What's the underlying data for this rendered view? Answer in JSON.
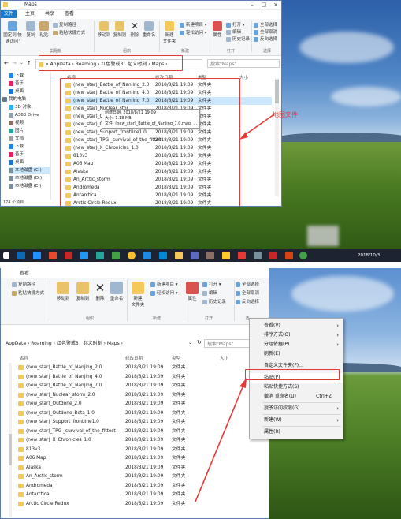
{
  "top": {
    "title": "Maps",
    "menu_tabs": [
      "文件",
      "主页",
      "共享",
      "查看"
    ],
    "ribbon": {
      "pin_label": "固定到'快速访问'",
      "copy_label": "复制",
      "paste_label": "粘贴",
      "copy_path": "复制路径",
      "paste_shortcut": "粘贴快捷方式",
      "move_to": "移动到",
      "copy_to": "复制到",
      "delete": "删除",
      "rename": "重命名",
      "new_folder": "新建\n文件夹",
      "new_item": "新建项目 ▾",
      "easy_access": "轻松访问 ▾",
      "properties": "属性",
      "open": "打开 ▾",
      "edit": "编辑",
      "history": "历史记录",
      "select_all": "全部选择",
      "select_none": "全部取消",
      "invert_select": "反向选择",
      "group_clipboard": "剪贴板",
      "group_organize": "组织",
      "group_new": "新建",
      "group_open": "打开",
      "group_select": "选择"
    },
    "address": [
      "AppData",
      "Roaming",
      "红色警戒3：起义时刻",
      "Maps"
    ],
    "search_placeholder": "搜索\"Maps\"",
    "columns": [
      "名称",
      "修改日期",
      "类型",
      "大小"
    ],
    "nav": [
      "下载",
      "音乐",
      "桌面",
      "我的电脑",
      "3D 对象",
      "A360 Drive",
      "视频",
      "图片",
      "文档",
      "下载",
      "音乐",
      "桌面",
      "本地磁盘 (C:)",
      "本地磁盘 (D:)",
      "本地磁盘 (E:)"
    ],
    "rows": [
      {
        "name": "(new_star)_Battle_of_Nanjing_2.0",
        "date": "2018/8/21 19:09",
        "type": "文件夹"
      },
      {
        "name": "(new_star)_Battle_of_Nanjing_4.0",
        "date": "2018/8/21 19:09",
        "type": "文件夹"
      },
      {
        "name": "(new_star)_Battle_of_Nanjing_7.0",
        "date": "2018/8/21 19:09",
        "type": "文件夹"
      },
      {
        "name": "(new_star)_Nuclear_stor",
        "date": "2018/8/21 19:09",
        "type": "文件夹"
      },
      {
        "name": "(new_star)_Outdone_2.0",
        "date": "2018/8/21 19:09",
        "type": "文件夹"
      },
      {
        "name": "(new_star)_Outdone_Beta",
        "date": "2018/8/21 19:09",
        "type": "文件夹"
      },
      {
        "name": "(new_star)_Support_frontline1.0",
        "date": "2018/8/21 19:09",
        "type": "文件夹"
      },
      {
        "name": "(new_star)_TPG-_survival_of_the_fittest",
        "date": "2018/8/21 19:09",
        "type": "文件夹"
      },
      {
        "name": "(new_star)_X_Chronicles_1.0",
        "date": "2018/8/21 19:09",
        "type": "文件夹"
      },
      {
        "name": "813v3",
        "date": "2018/8/21 19:09",
        "type": "文件夹"
      },
      {
        "name": "A06 Map",
        "date": "2018/8/21 19:09",
        "type": "文件夹"
      },
      {
        "name": "Alaska",
        "date": "2018/8/21 19:09",
        "type": "文件夹"
      },
      {
        "name": "An_Arctic_storm",
        "date": "2018/8/21 19:09",
        "type": "文件夹"
      },
      {
        "name": "Andromeda",
        "date": "2018/8/21 19:09",
        "type": "文件夹"
      },
      {
        "name": "Antarctica",
        "date": "2018/8/21 19:09",
        "type": "文件夹"
      },
      {
        "name": "Arctic Circle Redux",
        "date": "2018/8/21 19:09",
        "type": "文件夹"
      }
    ],
    "tooltip": [
      "创建日期: 2018/8/21 19:09",
      "大小: 1.18 MB",
      "文件: (new_star)_Battle_of_Nanjing_7.0.map, ..."
    ],
    "status": "174 个项目",
    "annotation": "地图文件",
    "taskbar_time": "2018/10/3"
  },
  "bottom": {
    "view_tab": "查看",
    "ribbon": {
      "copy_path": "复制路径",
      "paste_shortcut": "粘贴快捷方式",
      "move_to": "移动到",
      "copy_to": "复制到",
      "delete": "删除",
      "rename": "重命名",
      "new_folder": "新建\n文件夹",
      "new_item": "新建项目 ▾",
      "easy_access": "轻松访问 ▾",
      "properties": "属性",
      "open": "打开 ▾",
      "edit": "编辑",
      "history": "历史记录",
      "select_all": "全部选择",
      "select_none": "全部取消",
      "invert_select": "反向选择",
      "group_organize": "组织",
      "group_new": "新建",
      "group_open": "打开",
      "group_select": "选"
    },
    "address": [
      "AppData",
      "Roaming",
      "红色警戒3：起义时刻",
      "Maps"
    ],
    "search_placeholder": "搜索\"Maps\"",
    "columns": [
      "名称",
      "修改日期",
      "类型",
      "大小"
    ],
    "rows": [
      {
        "name": "(new_star)_Battle_of_Nanjing_2.0",
        "date": "2018/8/21 19:09",
        "type": "文件夹"
      },
      {
        "name": "(new_star)_Battle_of_Nanjing_4.0",
        "date": "2018/8/21 19:09",
        "type": "文件夹"
      },
      {
        "name": "(new_star)_Battle_of_Nanjing_7.0",
        "date": "2018/8/21 19:09",
        "type": "文件夹"
      },
      {
        "name": "(new_star)_Nuclear_storm_2.0",
        "date": "2018/8/21 19:09",
        "type": "文件夹"
      },
      {
        "name": "(new_star)_Outdone_2.0",
        "date": "2018/8/21 19:09",
        "type": "文件夹"
      },
      {
        "name": "(new_star)_Outdone_Beta_1.0",
        "date": "2018/8/21 19:09",
        "type": "文件夹"
      },
      {
        "name": "(new_star)_Support_frontline1.0",
        "date": "2018/8/21 19:09",
        "type": "文件夹"
      },
      {
        "name": "(new_star)_TPG-_survival_of_the_fittest",
        "date": "2018/8/21 19:09",
        "type": "文件夹"
      },
      {
        "name": "(new_star)_X_Chronicles_1.0",
        "date": "2018/8/21 19:09",
        "type": "文件夹"
      },
      {
        "name": "813v3",
        "date": "2018/8/21 19:09",
        "type": "文件夹"
      },
      {
        "name": "A06 Map",
        "date": "2018/8/21 19:09",
        "type": "文件夹"
      },
      {
        "name": "Alaska",
        "date": "2018/8/21 19:09",
        "type": "文件夹"
      },
      {
        "name": "An_Arctic_storm",
        "date": "2018/8/21 19:09",
        "type": "文件夹"
      },
      {
        "name": "Andromeda",
        "date": "2018/8/21 19:09",
        "type": "文件夹"
      },
      {
        "name": "Antarctica",
        "date": "2018/8/21 19:09",
        "type": "文件夹"
      },
      {
        "name": "Arctic Circle Redux",
        "date": "2018/8/21 19:09",
        "type": "文件夹"
      }
    ],
    "context_menu": [
      {
        "label": "查看(V)",
        "arrow": true
      },
      {
        "label": "排序方式(O)",
        "arrow": true
      },
      {
        "label": "分组依据(P)",
        "arrow": true
      },
      {
        "label": "刷新(E)"
      },
      {
        "sep": true
      },
      {
        "label": "自定义文件夹(F)..."
      },
      {
        "sep": true
      },
      {
        "label": "粘贴(P)",
        "highlight": true
      },
      {
        "label": "粘贴快捷方式(S)"
      },
      {
        "label": "撤消 重命名(U)",
        "shortcut": "Ctrl+Z"
      },
      {
        "sep": true
      },
      {
        "label": "授予访问权限(G)",
        "arrow": true
      },
      {
        "sep": true
      },
      {
        "label": "新建(W)",
        "arrow": true
      },
      {
        "sep": true
      },
      {
        "label": "属性(R)"
      }
    ]
  },
  "colors": {
    "accent": "#1979ca",
    "highlight_red": "#e53935",
    "folder": "#f4c85a"
  }
}
